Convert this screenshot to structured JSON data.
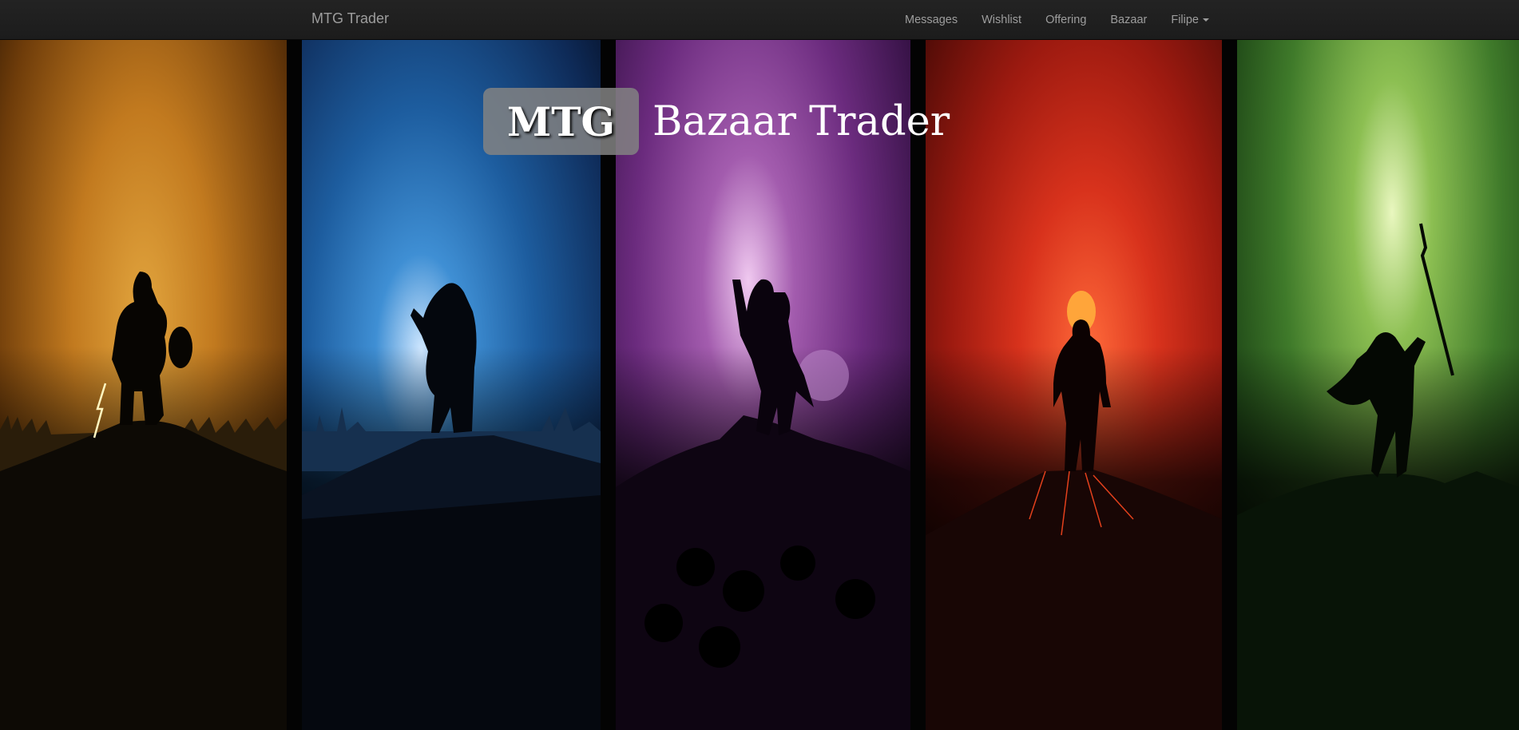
{
  "navbar": {
    "brand": "MTG Trader",
    "items": [
      {
        "label": "Messages"
      },
      {
        "label": "Wishlist"
      },
      {
        "label": "Offering"
      },
      {
        "label": "Bazaar"
      }
    ],
    "user_menu": {
      "label": "Filipe",
      "icon": "caret-down-icon"
    }
  },
  "hero": {
    "badge": "MTG",
    "title": "Bazaar Trader",
    "panels": [
      {
        "color_name": "white",
        "accent": "#e2a53e"
      },
      {
        "color_name": "blue",
        "accent": "#3f8fd4"
      },
      {
        "color_name": "black",
        "accent": "#a35cae"
      },
      {
        "color_name": "red",
        "accent": "#d8321c"
      },
      {
        "color_name": "green",
        "accent": "#8cbf52"
      }
    ]
  }
}
